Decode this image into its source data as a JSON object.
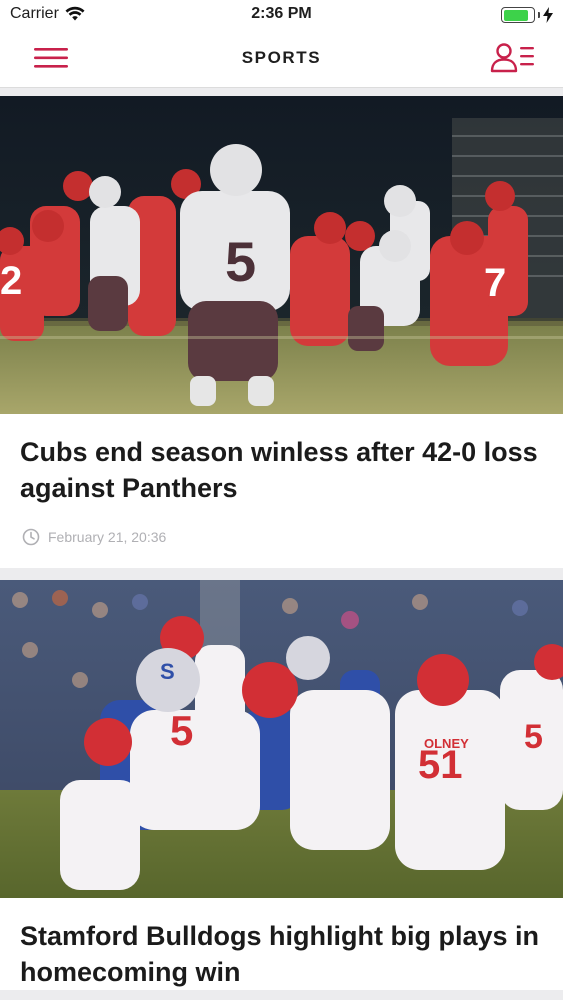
{
  "status": {
    "carrier": "Carrier",
    "time": "2:36 PM",
    "battery_level": 0.85
  },
  "header": {
    "title": "SPORTS",
    "menu_icon": "hamburger-icon",
    "profile_icon": "user-list-icon",
    "accent_color": "#c8214b"
  },
  "articles": [
    {
      "title": "Cubs end season winless after 42-0 loss against Panthers",
      "date": "February 21, 20:36",
      "image_icon": "football-game-night-photo"
    },
    {
      "title": "Stamford Bulldogs highlight big plays in homecoming win",
      "image_icon": "football-homecoming-photo"
    }
  ]
}
